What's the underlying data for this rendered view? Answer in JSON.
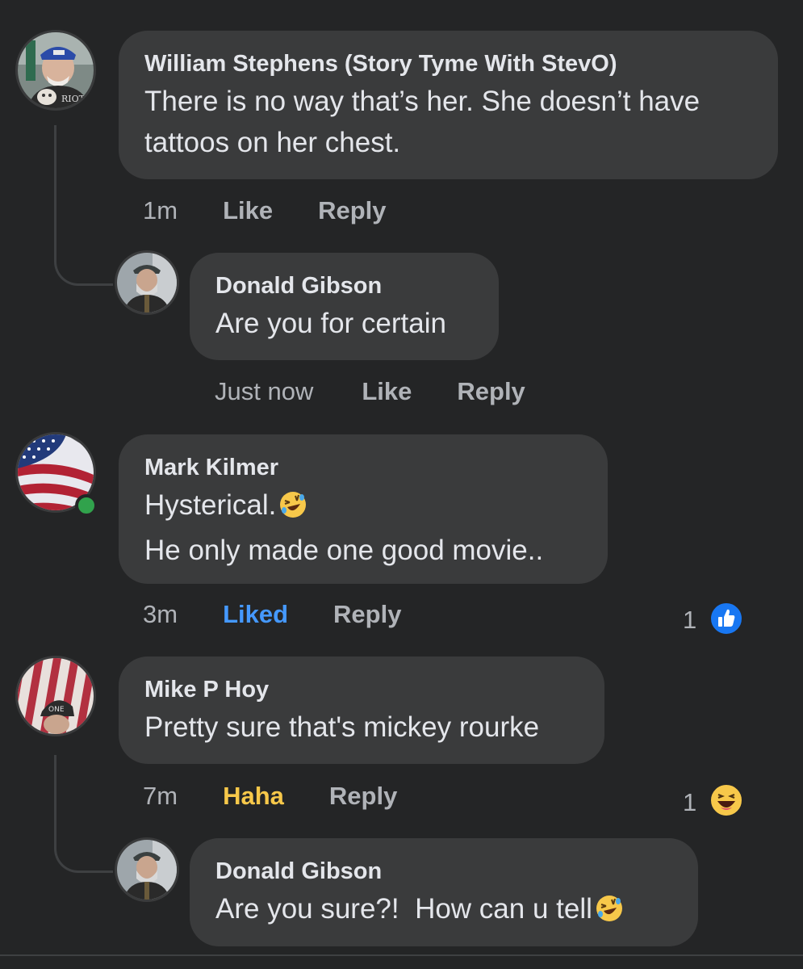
{
  "comments": [
    {
      "author": "William Stephens (Story Tyme With StevO)",
      "lines": [
        "There is no way that’s her. She doesn’t have",
        "tattoos on her chest."
      ],
      "time": "1m",
      "like_label": "Like",
      "reply_label": "Reply",
      "avatar_text": "RIOT"
    },
    {
      "author": "Donald Gibson",
      "lines": [
        "Are you for certain"
      ],
      "time": "Just now",
      "like_label": "Like",
      "reply_label": "Reply"
    },
    {
      "author": "Mark Kilmer",
      "lines": [
        "Hysterical.",
        "He only made one good movie.."
      ],
      "time": "3m",
      "like_label": "Liked",
      "reply_label": "Reply",
      "reaction_count": "1",
      "reaction_icon": "like-thumb-icon",
      "online": true
    },
    {
      "author": "Mike P Hoy",
      "lines": [
        "Pretty sure that's mickey rourke"
      ],
      "time": "7m",
      "like_label": "Haha",
      "reply_label": "Reply",
      "reaction_count": "1",
      "reaction_icon": "haha-emoji-icon",
      "avatar_text": "ONE"
    },
    {
      "author": "Donald Gibson",
      "lines": [
        "Are you sure?!  How can u tell"
      ],
      "time": "",
      "like_label": "",
      "reply_label": ""
    }
  ],
  "colors": {
    "background": "#242526",
    "bubble": "#3a3b3c",
    "text": "#e4e6eb",
    "secondary": "#b0b3b8",
    "liked": "#4599ff",
    "haha": "#f7c84a",
    "online": "#31a24c"
  }
}
